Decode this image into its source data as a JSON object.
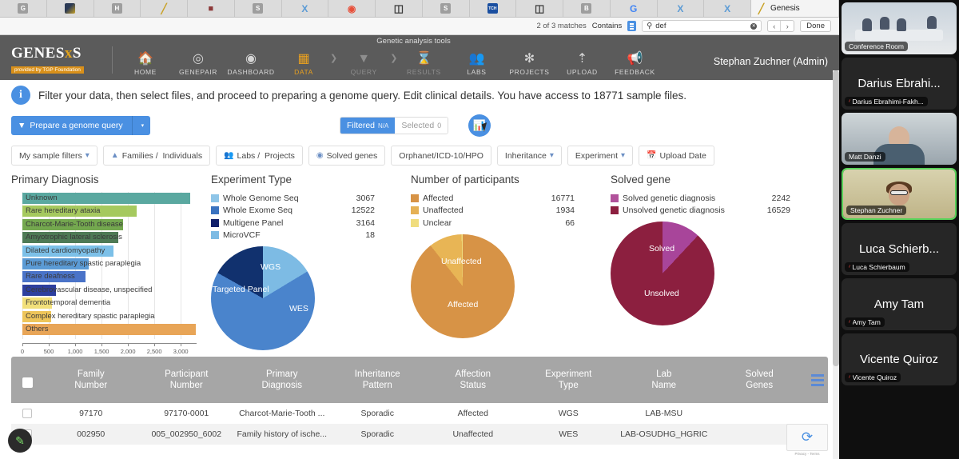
{
  "browser": {
    "tabs": [
      {
        "icon": "g-favicon",
        "label": ""
      },
      {
        "icon": "image-favicon",
        "label": ""
      },
      {
        "icon": "h-favicon",
        "label": ""
      },
      {
        "icon": "pen-favicon",
        "label": ""
      },
      {
        "icon": "book-favicon",
        "label": ""
      },
      {
        "icon": "s-favicon",
        "label": ""
      },
      {
        "icon": "x-favicon",
        "label": ""
      },
      {
        "icon": "orange-circle-favicon",
        "label": ""
      },
      {
        "icon": "d-favicon",
        "label": ""
      },
      {
        "icon": "s-favicon",
        "label": ""
      },
      {
        "icon": "tch-favicon",
        "label": ""
      },
      {
        "icon": "d-favicon",
        "label": ""
      },
      {
        "icon": "b-favicon",
        "label": ""
      },
      {
        "icon": "google-favicon",
        "label": ""
      },
      {
        "icon": "x-favicon",
        "label": ""
      },
      {
        "icon": "x-favicon",
        "label": ""
      }
    ],
    "active_tab": {
      "icon": "genesis-favicon",
      "label": "Genesis"
    },
    "find_bar": {
      "matches": "2 of 3 matches",
      "mode": "Contains",
      "query": "def",
      "placeholder": "Search",
      "prev": "‹",
      "next": "›",
      "done": "Done"
    }
  },
  "navbar": {
    "caption": "Genetic analysis tools",
    "logo_text": "GENES",
    "logo_text_tail": "S",
    "logo_sub": "provided by TGP Foundation",
    "items": [
      {
        "label": "HOME",
        "icon": "home-icon",
        "state": "normal"
      },
      {
        "label": "GENEPAIR",
        "icon": "target-icon",
        "state": "normal"
      },
      {
        "label": "DASHBOARD",
        "icon": "gauge-icon",
        "state": "normal"
      },
      {
        "label": "DATA",
        "icon": "database-icon",
        "state": "active"
      },
      {
        "label": "QUERY",
        "icon": "funnel-icon",
        "state": "dim"
      },
      {
        "label": "RESULTS",
        "icon": "hourglass-icon",
        "state": "dim"
      },
      {
        "label": "LABS",
        "icon": "people-icon",
        "state": "normal"
      },
      {
        "label": "PROJECTS",
        "icon": "chromosome-icon",
        "state": "normal"
      },
      {
        "label": "UPLOAD",
        "icon": "upload-icon",
        "state": "normal"
      },
      {
        "label": "FEEDBACK",
        "icon": "megaphone-icon",
        "state": "normal"
      }
    ],
    "user": "Stephan Zuchner (Admin)"
  },
  "info_banner": {
    "icon": "info-icon",
    "text": "Filter your data, then select files, and proceed to preparing a genome query. Edit clinical details. You have access to 18771 sample files."
  },
  "actions": {
    "prepare_query": "Prepare a genome query",
    "caret": "▾",
    "filtered_label": "Filtered",
    "filtered_value": "N/A",
    "selected_label": "Selected",
    "selected_value": "0",
    "chart_toggle_icon": "bar-chart-icon"
  },
  "filters": [
    {
      "label": "My sample filters",
      "icon": "chevron-down-icon",
      "caret": "▾"
    },
    {
      "label": "Families /  Individuals",
      "icon": "family-icon",
      "caret": ""
    },
    {
      "label": "Labs /  Projects",
      "icon": "labs-icon",
      "caret": ""
    },
    {
      "label": "Solved genes",
      "icon": "shield-icon",
      "caret": ""
    },
    {
      "label": "Orphanet/ICD-10/HPO",
      "icon": "",
      "caret": ""
    },
    {
      "label": "Inheritance",
      "icon": "",
      "caret": "▾"
    },
    {
      "label": "Experiment",
      "icon": "",
      "caret": "▾"
    },
    {
      "label": "Upload Date",
      "icon": "calendar-icon",
      "caret": ""
    }
  ],
  "chart_data": [
    {
      "type": "bar",
      "title": "Primary Diagnosis",
      "orientation": "horizontal",
      "xlabel": "",
      "ylabel": "",
      "xlim": [
        0,
        3300
      ],
      "ticks": [
        0,
        500,
        1000,
        1500,
        2000,
        2500,
        3000
      ],
      "tick_labels": [
        "0",
        "500",
        "1,000",
        "1,500",
        "2,000",
        "2,500",
        "3,000"
      ],
      "grid": true,
      "categories": [
        "Unknown",
        "Rare hereditary ataxia",
        "Charcot-Marie-Tooth disease",
        "Amyotrophic lateral sclerosis",
        "Dilated cardiomyopathy",
        "Pure hereditary spastic paraplegia",
        "Rare deafness",
        "Cerebrovascular disease, unspecified",
        "Frontotemporal dementia",
        "Complex hereditary spastic paraplegia",
        "Others"
      ],
      "values": [
        3180,
        2160,
        1900,
        1810,
        1730,
        1250,
        1200,
        630,
        560,
        540,
        3280
      ],
      "colors": [
        "#5aa8a0",
        "#a5c95e",
        "#74a84f",
        "#4e7a55",
        "#7cc0e8",
        "#5b9bd5",
        "#4a73c8",
        "#2d3f9e",
        "#f2e07a",
        "#eec55a",
        "#e8a557"
      ]
    },
    {
      "type": "pie",
      "title": "Experiment Type",
      "legend_position": "top",
      "legend": [
        {
          "name": "Whole Genome Seq",
          "value": 3067,
          "color": "#8ec5e8"
        },
        {
          "name": "Whole Exome Seq",
          "value": 12522,
          "color": "#3a73c0"
        },
        {
          "name": "Multigene Panel",
          "value": 3164,
          "color": "#11206b"
        },
        {
          "name": "MicroVCF",
          "value": 18,
          "color": "#7dbbe4"
        }
      ],
      "categories": [
        "WGS",
        "WES",
        "Targeted Panel"
      ],
      "values": [
        3067,
        12522,
        3164
      ],
      "slice_colors": [
        "#7dbbe4",
        "#4a84cc",
        "#11316e"
      ],
      "labels": [
        "WGS",
        "WES",
        "Targeted Panel"
      ]
    },
    {
      "type": "pie",
      "title": "Number of participants",
      "legend_position": "top",
      "legend": [
        {
          "name": "Affected",
          "value": 16771,
          "color": "#d79346"
        },
        {
          "name": "Unaffected",
          "value": 1934,
          "color": "#e5b155"
        },
        {
          "name": "Unclear",
          "value": 66,
          "color": "#f0dd7e"
        }
      ],
      "categories": [
        "Affected",
        "Unaffected",
        "Unclear"
      ],
      "values": [
        16771,
        1934,
        66
      ],
      "slice_colors": [
        "#d79346",
        "#e8b555",
        "#f0dd7e"
      ],
      "labels": [
        "Affected",
        "Unaffected"
      ]
    },
    {
      "type": "pie",
      "title": "Solved gene",
      "legend_position": "top",
      "legend": [
        {
          "name": "Solved genetic diagnosis",
          "value": 2242,
          "color": "#b1529b"
        },
        {
          "name": "Unsolved genetic diagnosis",
          "value": 16529,
          "color": "#8c1f3f"
        }
      ],
      "categories": [
        "Solved",
        "Unsolved"
      ],
      "values": [
        2242,
        16529
      ],
      "slice_colors": [
        "#a8459a",
        "#8c1f3f"
      ],
      "labels": [
        "Solved",
        "Unsolved"
      ]
    }
  ],
  "table": {
    "select_all_icon": "checkbox",
    "columns": [
      "Family\nNumber",
      "Participant\nNumber",
      "Primary\nDiagnosis",
      "Inheritance\nPattern",
      "Affection\nStatus",
      "Experiment\nType",
      "Lab\nName",
      "Solved\nGenes"
    ],
    "sort_icon": "sort-lines-icon",
    "rows": [
      {
        "family_number": "97170",
        "participant_number": "97170-0001",
        "primary_diagnosis": "Charcot-Marie-Tooth ...",
        "inheritance_pattern": "Sporadic",
        "affection_status": "Affected",
        "experiment_type": "WGS",
        "lab_name": "LAB-MSU",
        "solved_genes": ""
      },
      {
        "family_number": "002950",
        "participant_number": "005_002950_6002",
        "primary_diagnosis": "Family history of ische...",
        "inheritance_pattern": "Sporadic",
        "affection_status": "Unaffected",
        "experiment_type": "WES",
        "lab_name": "LAB-OSUDHG_HGRIC",
        "solved_genes": ""
      }
    ]
  },
  "floating": {
    "edit_icon": "pencil-icon",
    "recaptcha_label": "Privacy - Terms",
    "recaptcha_icon": "recaptcha-icon"
  },
  "zoom_sidebar": {
    "participants": [
      {
        "display_name": "",
        "pill_name": "Conference Room",
        "muted": false,
        "has_video": true,
        "thumb": "conference-room",
        "speaking": false
      },
      {
        "display_name": "Darius Ebrahi...",
        "pill_name": "Darius Ebrahimi-Fakh...",
        "muted": true,
        "has_video": false,
        "thumb": "",
        "speaking": false
      },
      {
        "display_name": "",
        "pill_name": "Matt Danzi",
        "muted": false,
        "has_video": true,
        "thumb": "man",
        "speaking": false
      },
      {
        "display_name": "",
        "pill_name": "Stephan Zuchner",
        "muted": false,
        "has_video": true,
        "thumb": "stephan",
        "speaking": true
      },
      {
        "display_name": "Luca Schierb...",
        "pill_name": "Luca Schierbaum",
        "muted": true,
        "has_video": false,
        "thumb": "",
        "speaking": false
      },
      {
        "display_name": "Amy Tam",
        "pill_name": "Amy Tam",
        "muted": true,
        "has_video": false,
        "thumb": "",
        "speaking": false
      },
      {
        "display_name": "Vicente Quiroz",
        "pill_name": "Vicente Quiroz",
        "muted": true,
        "has_video": false,
        "thumb": "",
        "speaking": false
      }
    ],
    "mute_glyph": "∕"
  },
  "colors": {
    "accent": "#4a90e2",
    "navbar": "#5b5b5b",
    "active_nav": "#e8a020",
    "table_header": "#a6a6a6"
  }
}
